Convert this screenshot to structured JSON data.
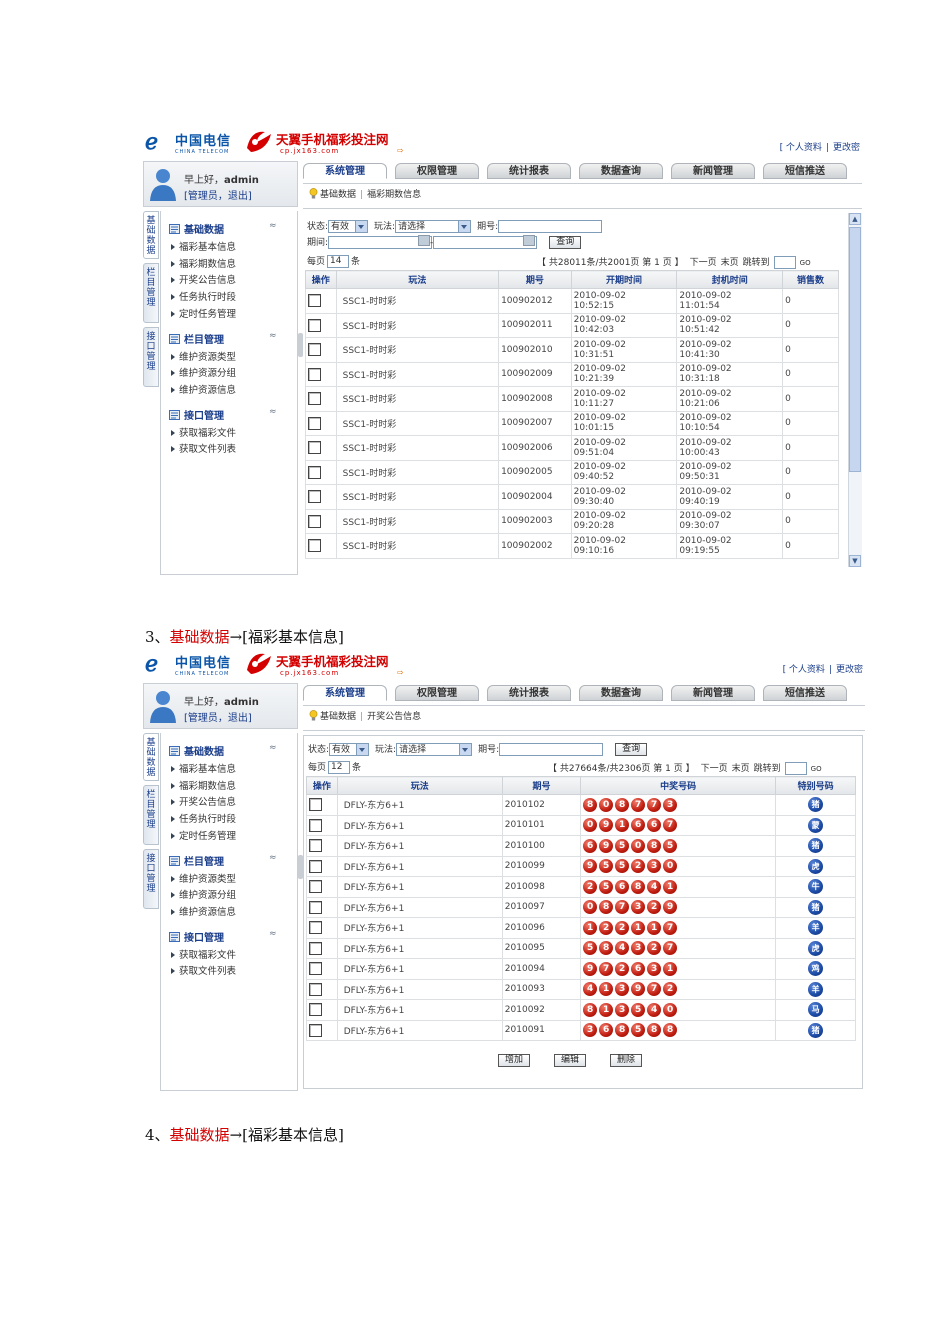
{
  "captions": [
    {
      "num": "3、",
      "red": "基础数据",
      "rest": "→[福彩基本信息]"
    },
    {
      "num": "4、",
      "red": "基础数据",
      "rest": "→[福彩基本信息]"
    }
  ],
  "header": {
    "ct_logo_cn": "中国电信",
    "ct_logo_en": "CHINA TELECOM",
    "cp_title": "天翼手机福彩投注网",
    "cp_url": "cp.jx163.com",
    "link_profile": "[ 个人资料",
    "link_sep": "|",
    "link_password": "更改密"
  },
  "user": {
    "greeting_prefix": "早上好，",
    "username": "admin",
    "role_line": "[管理员，退出]"
  },
  "tabs": [
    "系统管理",
    "权限管理",
    "统计报表",
    "数据查询",
    "新闻管理",
    "短信推送"
  ],
  "side_tabs": [
    "基础数据",
    "栏目管理",
    "接口管理"
  ],
  "menu": {
    "groups": [
      {
        "title": "基础数据",
        "items": [
          "福彩基本信息",
          "福彩期数信息",
          "开奖公告信息",
          "任务执行时段",
          "定时任务管理"
        ]
      },
      {
        "title": "栏目管理",
        "items": [
          "维护资源类型",
          "维护资源分组",
          "维护资源信息"
        ]
      },
      {
        "title": "接口管理",
        "items": [
          "获取福彩文件",
          "获取文件列表"
        ]
      }
    ],
    "collapse_glyph": "≈"
  },
  "screen1": {
    "breadcrumb": [
      "基础数据",
      "福彩期数信息"
    ],
    "filters": {
      "status_label": "状态:",
      "status_value": "有效",
      "play_label": "玩法:",
      "play_value": "请选择",
      "issue_label": "期号:",
      "period_label": "期间:",
      "period_sep": "-",
      "query_button": "查询",
      "page_size_label": "每页",
      "page_size_value": "14",
      "page_size_unit": "条"
    },
    "pager": {
      "summary": "【 共28011条/共2001页 第 1 页 】",
      "next": "下一页",
      "last": "末页",
      "jump": "跳转到",
      "go": "GO"
    },
    "columns": [
      "操作",
      "玩法",
      "期号",
      "开期时间",
      "封机时间",
      "销售数"
    ],
    "rows": [
      {
        "play": "SSC1-时时彩",
        "issue": "100902012",
        "open_d": "2010-09-02",
        "open_t": "10:52:15",
        "close_d": "2010-09-02",
        "close_t": "11:01:54",
        "sales": "0"
      },
      {
        "play": "SSC1-时时彩",
        "issue": "100902011",
        "open_d": "2010-09-02",
        "open_t": "10:42:03",
        "close_d": "2010-09-02",
        "close_t": "10:51:42",
        "sales": "0"
      },
      {
        "play": "SSC1-时时彩",
        "issue": "100902010",
        "open_d": "2010-09-02",
        "open_t": "10:31:51",
        "close_d": "2010-09-02",
        "close_t": "10:41:30",
        "sales": "0"
      },
      {
        "play": "SSC1-时时彩",
        "issue": "100902009",
        "open_d": "2010-09-02",
        "open_t": "10:21:39",
        "close_d": "2010-09-02",
        "close_t": "10:31:18",
        "sales": "0"
      },
      {
        "play": "SSC1-时时彩",
        "issue": "100902008",
        "open_d": "2010-09-02",
        "open_t": "10:11:27",
        "close_d": "2010-09-02",
        "close_t": "10:21:06",
        "sales": "0"
      },
      {
        "play": "SSC1-时时彩",
        "issue": "100902007",
        "open_d": "2010-09-02",
        "open_t": "10:01:15",
        "close_d": "2010-09-02",
        "close_t": "10:10:54",
        "sales": "0"
      },
      {
        "play": "SSC1-时时彩",
        "issue": "100902006",
        "open_d": "2010-09-02",
        "open_t": "09:51:04",
        "close_d": "2010-09-02",
        "close_t": "10:00:43",
        "sales": "0"
      },
      {
        "play": "SSC1-时时彩",
        "issue": "100902005",
        "open_d": "2010-09-02",
        "open_t": "09:40:52",
        "close_d": "2010-09-02",
        "close_t": "09:50:31",
        "sales": "0"
      },
      {
        "play": "SSC1-时时彩",
        "issue": "100902004",
        "open_d": "2010-09-02",
        "open_t": "09:30:40",
        "close_d": "2010-09-02",
        "close_t": "09:40:19",
        "sales": "0"
      },
      {
        "play": "SSC1-时时彩",
        "issue": "100902003",
        "open_d": "2010-09-02",
        "open_t": "09:20:28",
        "close_d": "2010-09-02",
        "close_t": "09:30:07",
        "sales": "0"
      },
      {
        "play": "SSC1-时时彩",
        "issue": "100902002",
        "open_d": "2010-09-02",
        "open_t": "09:10:16",
        "close_d": "2010-09-02",
        "close_t": "09:19:55",
        "sales": "0"
      }
    ]
  },
  "screen2": {
    "breadcrumb": [
      "基础数据",
      "开奖公告信息"
    ],
    "filters": {
      "status_label": "状态:",
      "status_value": "有效",
      "play_label": "玩法:",
      "play_value": "请选择",
      "issue_label": "期号:",
      "query_button": "查询",
      "page_size_label": "每页",
      "page_size_value": "12",
      "page_size_unit": "条"
    },
    "pager": {
      "summary": "【 共27664条/共2306页 第 1 页 】",
      "next": "下一页",
      "last": "末页",
      "jump": "跳转到",
      "go": "GO"
    },
    "columns": [
      "操作",
      "玩法",
      "期号",
      "中奖号码",
      "特别号码"
    ],
    "rows": [
      {
        "play": "DFLY-东方6+1",
        "issue": "2010102",
        "balls": [
          "8",
          "0",
          "8",
          "7",
          "7",
          "3"
        ],
        "special": "猪"
      },
      {
        "play": "DFLY-东方6+1",
        "issue": "2010101",
        "balls": [
          "0",
          "9",
          "1",
          "6",
          "6",
          "7"
        ],
        "special": "蒙"
      },
      {
        "play": "DFLY-东方6+1",
        "issue": "2010100",
        "balls": [
          "6",
          "9",
          "5",
          "0",
          "8",
          "5"
        ],
        "special": "猪"
      },
      {
        "play": "DFLY-东方6+1",
        "issue": "2010099",
        "balls": [
          "9",
          "5",
          "5",
          "2",
          "3",
          "0"
        ],
        "special": "虎"
      },
      {
        "play": "DFLY-东方6+1",
        "issue": "2010098",
        "balls": [
          "2",
          "5",
          "6",
          "8",
          "4",
          "1"
        ],
        "special": "牛"
      },
      {
        "play": "DFLY-东方6+1",
        "issue": "2010097",
        "balls": [
          "0",
          "8",
          "7",
          "3",
          "2",
          "9"
        ],
        "special": "猪"
      },
      {
        "play": "DFLY-东方6+1",
        "issue": "2010096",
        "balls": [
          "1",
          "2",
          "2",
          "1",
          "1",
          "7"
        ],
        "special": "羊"
      },
      {
        "play": "DFLY-东方6+1",
        "issue": "2010095",
        "balls": [
          "5",
          "8",
          "4",
          "3",
          "2",
          "7"
        ],
        "special": "虎"
      },
      {
        "play": "DFLY-东方6+1",
        "issue": "2010094",
        "balls": [
          "9",
          "7",
          "2",
          "6",
          "3",
          "1"
        ],
        "special": "鸡"
      },
      {
        "play": "DFLY-东方6+1",
        "issue": "2010093",
        "balls": [
          "4",
          "1",
          "3",
          "9",
          "7",
          "2"
        ],
        "special": "羊"
      },
      {
        "play": "DFLY-东方6+1",
        "issue": "2010092",
        "balls": [
          "8",
          "1",
          "3",
          "5",
          "4",
          "0"
        ],
        "special": "马"
      },
      {
        "play": "DFLY-东方6+1",
        "issue": "2010091",
        "balls": [
          "3",
          "6",
          "8",
          "5",
          "8",
          "8"
        ],
        "special": "猪"
      }
    ],
    "buttons": [
      "增加",
      "编辑",
      "删除"
    ]
  },
  "colors": {
    "brand_red": "#d40000",
    "telecom_blue": "#0b55a8",
    "ball_red": "#c01d10",
    "ball_blue": "#1b4aa5"
  }
}
